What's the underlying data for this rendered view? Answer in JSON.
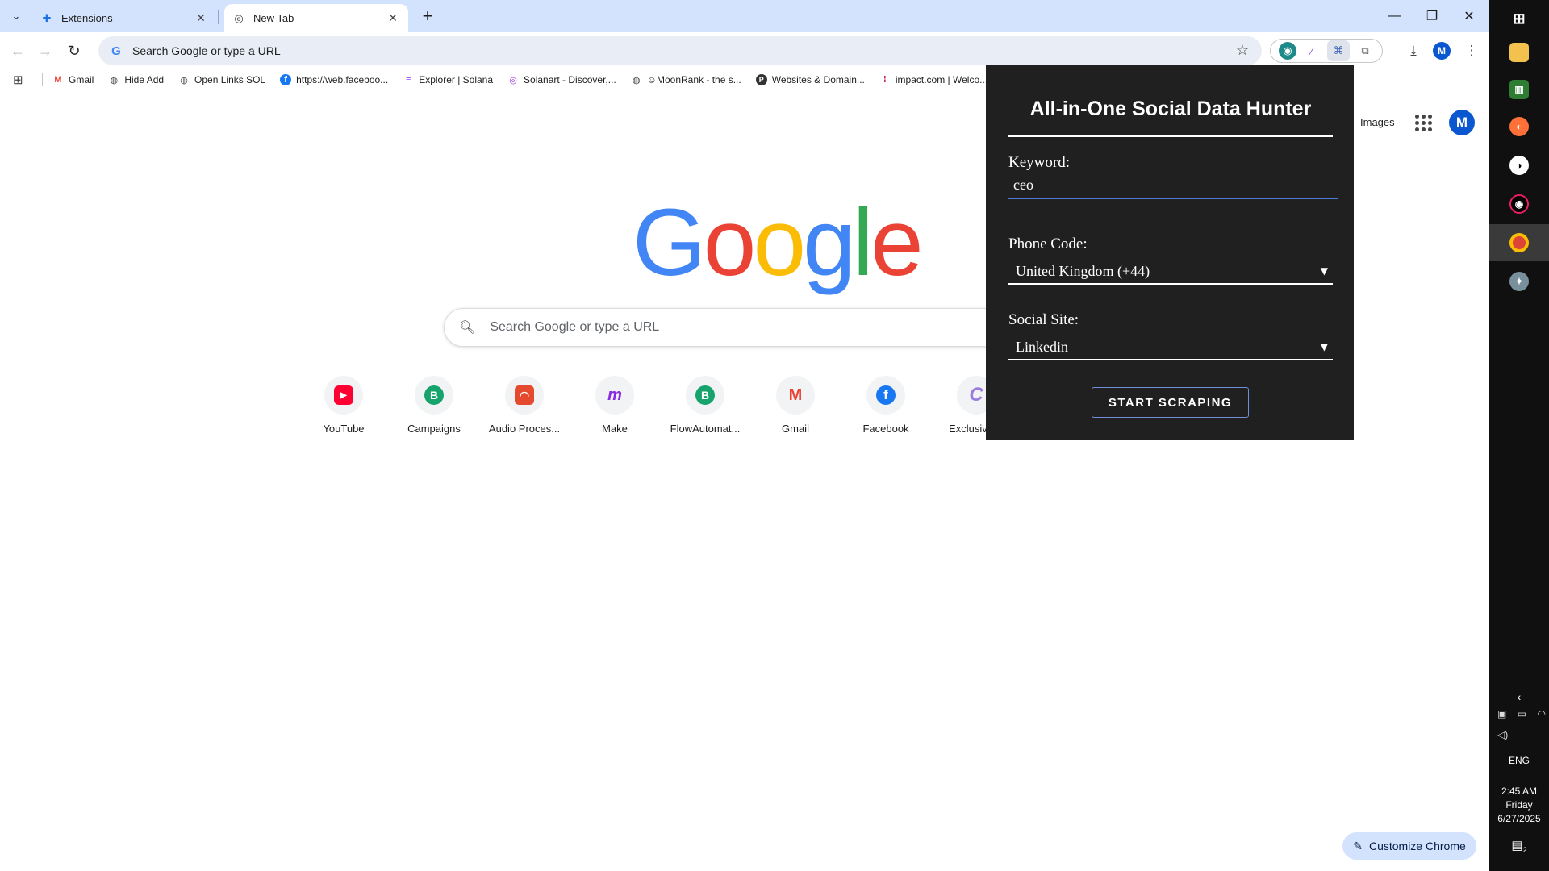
{
  "tabs": [
    {
      "title": "Extensions",
      "favicon": "puzzle-icon",
      "active": false
    },
    {
      "title": "New Tab",
      "favicon": "chrome-icon",
      "active": true
    }
  ],
  "omnibox": {
    "placeholder": "Search Google or type a URL"
  },
  "bookmarks": [
    {
      "label": "Gmail",
      "icon": "gmail-icon",
      "color": "#ea4335"
    },
    {
      "label": "Hide Add",
      "icon": "globe-icon",
      "color": "#444444"
    },
    {
      "label": "Open Links SOL",
      "icon": "globe-icon",
      "color": "#444444"
    },
    {
      "label": "https://web.faceboo...",
      "icon": "facebook-icon",
      "color": "#1877f2"
    },
    {
      "label": "Explorer | Solana",
      "icon": "solana-icon",
      "color": "#9945ff"
    },
    {
      "label": "Solanart - Discover,...",
      "icon": "solanart-icon",
      "color": "#a23bd8"
    },
    {
      "label": "☺MoonRank - the s...",
      "icon": "globe-icon",
      "color": "#444444"
    },
    {
      "label": "Websites & Domain...",
      "icon": "p-icon",
      "color": "#333333"
    },
    {
      "label": "impact.com | Welco...",
      "icon": "impact-icon",
      "color": "#c2185b"
    }
  ],
  "ntp": {
    "images_link": "Images",
    "logo": [
      "G",
      "o",
      "o",
      "g",
      "l",
      "e"
    ],
    "search_placeholder": "Search Google or type a URL",
    "shortcuts": [
      {
        "label": "YouTube",
        "icon": "youtube-icon",
        "color": "#ff0033",
        "glyph": "▶"
      },
      {
        "label": "Campaigns",
        "icon": "campaigns-icon",
        "color": "#16a36c",
        "glyph": "B"
      },
      {
        "label": "Audio Proces...",
        "icon": "audio-icon",
        "color": "#e64a2e",
        "glyph": "◠"
      },
      {
        "label": "Make",
        "icon": "make-icon",
        "color": "#8a2be2",
        "glyph": "m"
      },
      {
        "label": "FlowAutomat...",
        "icon": "flow-icon",
        "color": "#16a36c",
        "glyph": "B"
      },
      {
        "label": "Gmail",
        "icon": "gmail-icon",
        "color": "#ea4335",
        "glyph": "M"
      },
      {
        "label": "Facebook",
        "icon": "facebook-icon",
        "color": "#1877f2",
        "glyph": "f"
      },
      {
        "label": "Exclusive C",
        "icon": "exclusive-icon",
        "color": "#9c7be0",
        "glyph": "C"
      }
    ],
    "customize_label": "Customize Chrome"
  },
  "profile_initial": "M",
  "popup": {
    "title": "All-in-One Social Data Hunter",
    "keyword_label": "Keyword:",
    "keyword_value": "ceo",
    "phone_label": "Phone Code:",
    "phone_value": "United Kingdom (+44)",
    "site_label": "Social Site:",
    "site_value": "Linkedin",
    "start_label": "START SCRAPING"
  },
  "taskbar": {
    "language": "ENG",
    "time": "2:45 AM",
    "day": "Friday",
    "date": "6/27/2025",
    "notifications": "2"
  },
  "colors": {
    "tabstrip": "#d3e3fd",
    "popup_bg": "#202020",
    "accent": "#0b57d0"
  }
}
